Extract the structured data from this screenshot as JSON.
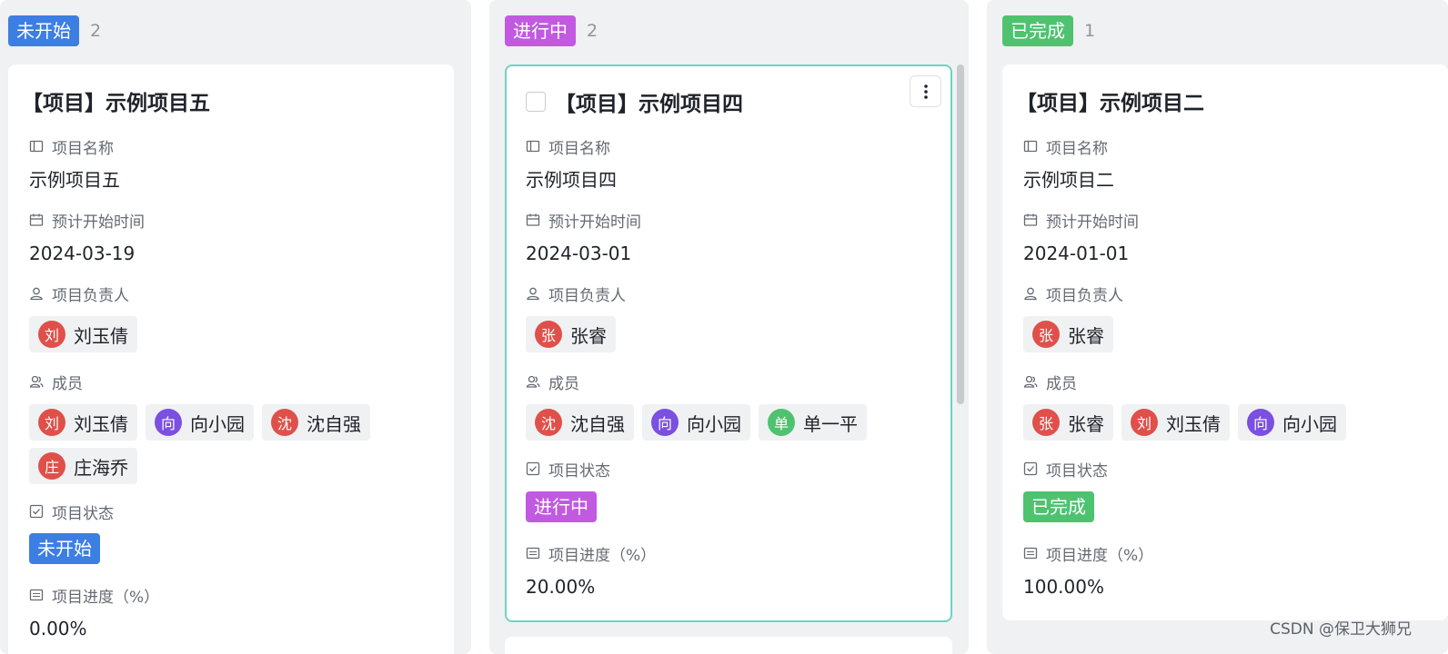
{
  "colors": {
    "not_started": "#3d7ee3",
    "in_progress": "#c15ae0",
    "done": "#4fc26f",
    "avatar_red": "#e0504a",
    "avatar_purple": "#7b4fe0",
    "avatar_green": "#4fc26f",
    "active_card_border": "#6ed4c2"
  },
  "columns": [
    {
      "status": "未开始",
      "count": "2",
      "card": {
        "title": "【项目】示例项目五",
        "name_label": "项目名称",
        "name_value": "示例项目五",
        "start_label": "预计开始时间",
        "start_value": "2024-03-19",
        "owner_label": "项目负责人",
        "owners": [
          {
            "avatar": "刘",
            "name": "刘玉倩"
          }
        ],
        "members_label": "成员",
        "members": [
          {
            "avatar": "刘",
            "name": "刘玉倩"
          },
          {
            "avatar": "向",
            "name": "向小园"
          },
          {
            "avatar": "沈",
            "name": "沈自强"
          },
          {
            "avatar": "庄",
            "name": "庄海乔"
          }
        ],
        "state_label": "项目状态",
        "state_value": "未开始",
        "progress_label": "项目进度（%）",
        "progress_value": "0.00%"
      }
    },
    {
      "status": "进行中",
      "count": "2",
      "card": {
        "title": "【项目】示例项目四",
        "name_label": "项目名称",
        "name_value": "示例项目四",
        "start_label": "预计开始时间",
        "start_value": "2024-03-01",
        "owner_label": "项目负责人",
        "owners": [
          {
            "avatar": "张",
            "name": "张睿"
          }
        ],
        "members_label": "成员",
        "members": [
          {
            "avatar": "沈",
            "name": "沈自强"
          },
          {
            "avatar": "向",
            "name": "向小园"
          },
          {
            "avatar": "单",
            "name": "单一平"
          }
        ],
        "state_label": "项目状态",
        "state_value": "进行中",
        "progress_label": "项目进度（%）",
        "progress_value": "20.00%"
      }
    },
    {
      "status": "已完成",
      "count": "1",
      "card": {
        "title": "【项目】示例项目二",
        "name_label": "项目名称",
        "name_value": "示例项目二",
        "start_label": "预计开始时间",
        "start_value": "2024-01-01",
        "owner_label": "项目负责人",
        "owners": [
          {
            "avatar": "张",
            "name": "张睿"
          }
        ],
        "members_label": "成员",
        "members": [
          {
            "avatar": "张",
            "name": "张睿"
          },
          {
            "avatar": "刘",
            "name": "刘玉倩"
          },
          {
            "avatar": "向",
            "name": "向小园"
          }
        ],
        "state_label": "项目状态",
        "state_value": "已完成",
        "progress_label": "项目进度（%）",
        "progress_value": "100.00%"
      }
    }
  ],
  "watermark": "CSDN @保卫大狮兄"
}
